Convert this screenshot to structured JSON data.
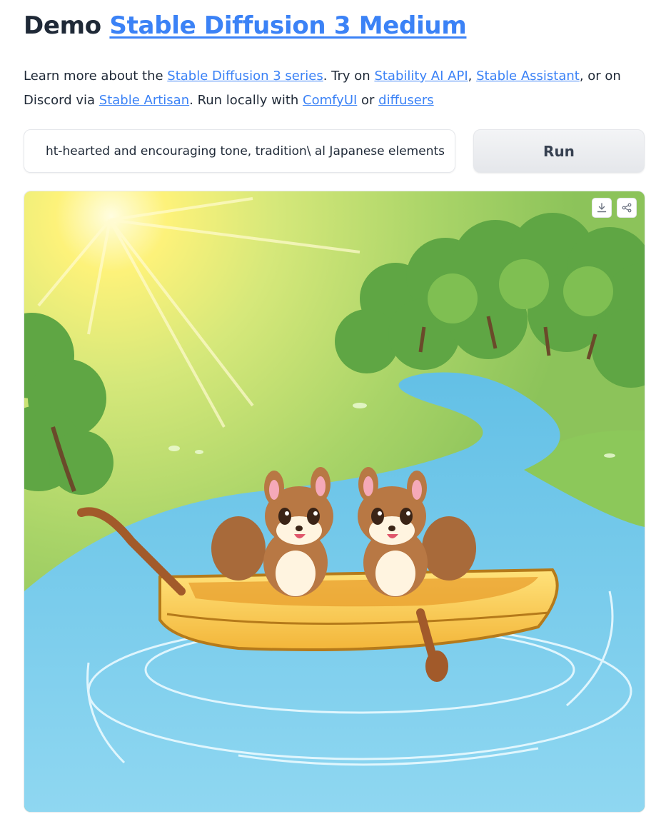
{
  "header": {
    "prefix": "Demo",
    "link_text": "Stable Diffusion 3 Medium"
  },
  "description": {
    "t1": "Learn more about the ",
    "link_series": "Stable Diffusion 3 series",
    "t2": ". Try on ",
    "link_api": "Stability AI API",
    "t3": ", ",
    "link_assistant": "Stable Assistant",
    "t4": ", or on Discord via ",
    "link_artisan": "Stable Artisan",
    "t5": ". Run locally with ",
    "link_comfy": "ComfyUI",
    "t6": " or ",
    "link_diffusers": "diffusers"
  },
  "prompt": {
    "value": "ht-hearted and encouraging tone, tradition\\ al Japanese elements"
  },
  "run_button": {
    "label": "Run"
  },
  "image": {
    "toolbar": {
      "download_icon": "download-icon",
      "share_icon": "share-icon"
    }
  },
  "colors": {
    "link": "#3b82f6",
    "button_bg": "#e5e7eb",
    "text": "#1f2937"
  }
}
